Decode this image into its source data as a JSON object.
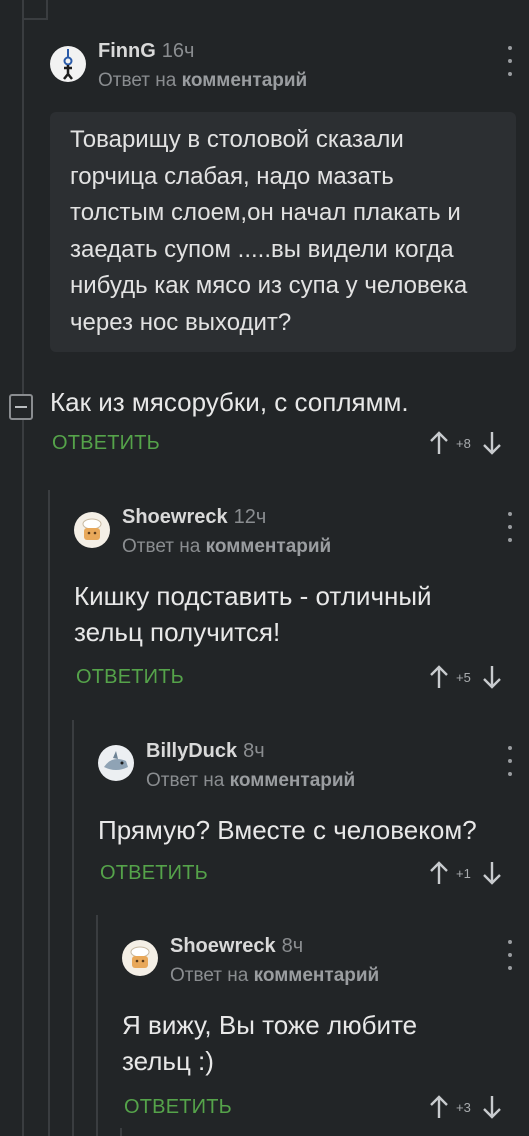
{
  "root_comment": {
    "username": "FinnG",
    "time": "16ч",
    "reply_prefix": "Ответ на",
    "reply_link": "комментарий",
    "quote": "Товарищу в столовой сказали горчица слабая, надо мазать толстым слоем,он начал плакать и заедать супом .....вы видели когда нибудь как мясо из супа у человека через нос выходит?",
    "text": "Как из мясорубки, с соплямм.",
    "reply_label": "ОТВЕТИТЬ",
    "score": "+8"
  },
  "replies": [
    {
      "username": "Shoewreck",
      "time": "12ч",
      "reply_prefix": "Ответ на",
      "reply_link": "комментарий",
      "text": "Кишку подставить - отличный зельц получится!",
      "reply_label": "ОТВЕТИТЬ",
      "score": "+5"
    },
    {
      "username": "BillyDuck",
      "time": "8ч",
      "reply_prefix": "Ответ на",
      "reply_link": "комментарий",
      "text": "Прямую? Вместе с человеком?",
      "reply_label": "ОТВЕТИТЬ",
      "score": "+1"
    },
    {
      "username": "Shoewreck",
      "time": "8ч",
      "reply_prefix": "Ответ на",
      "reply_link": "комментарий",
      "text": "Я вижу, Вы тоже любите зельц :)",
      "reply_label": "ОТВЕТИТЬ",
      "score": "+3"
    }
  ],
  "colors": {
    "background": "#222527",
    "reply_green": "#55a34a",
    "thread_line": "#3a3d40",
    "quote_bg": "#2c2f32"
  },
  "icons": {
    "collapse": "collapse-minus-icon",
    "upvote": "arrow-up-icon",
    "downvote": "arrow-down-icon",
    "more": "more-vertical-icon"
  }
}
